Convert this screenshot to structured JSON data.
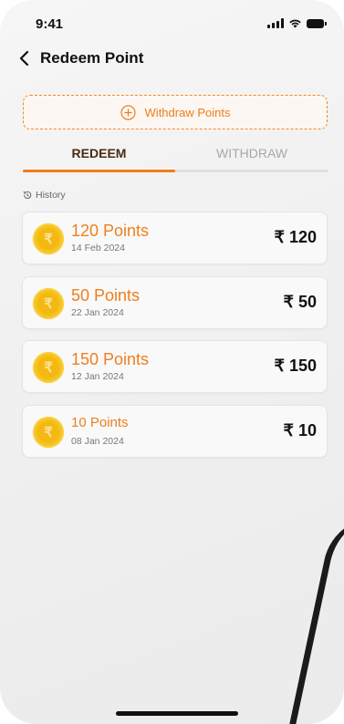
{
  "status_bar": {
    "time": "9:41"
  },
  "header": {
    "title": "Redeem Point"
  },
  "withdraw_button": {
    "label": "Withdraw Points"
  },
  "tabs": [
    {
      "label": "REDEEM",
      "active": true
    },
    {
      "label": "WITHDRAW",
      "active": false
    }
  ],
  "history": {
    "label": "History",
    "items": [
      {
        "points": "120 Points",
        "date": "14 Feb 2024",
        "amount": "₹ 120",
        "coin_symbol": "₹"
      },
      {
        "points": "50 Points",
        "date": "22 Jan 2024",
        "amount": "₹ 50",
        "coin_symbol": "₹"
      },
      {
        "points": "150 Points",
        "date": "12 Jan 2024",
        "amount": "₹ 150",
        "coin_symbol": "₹"
      },
      {
        "points": "10 Points",
        "date": "08 Jan 2024",
        "amount": "₹ 10",
        "coin_symbol": "₹"
      }
    ]
  },
  "colors": {
    "accent": "#F07D1A",
    "coin": "#F6C21C",
    "active_tab_text": "#4A2A12",
    "inactive_tab_text": "#A8A8A8"
  }
}
